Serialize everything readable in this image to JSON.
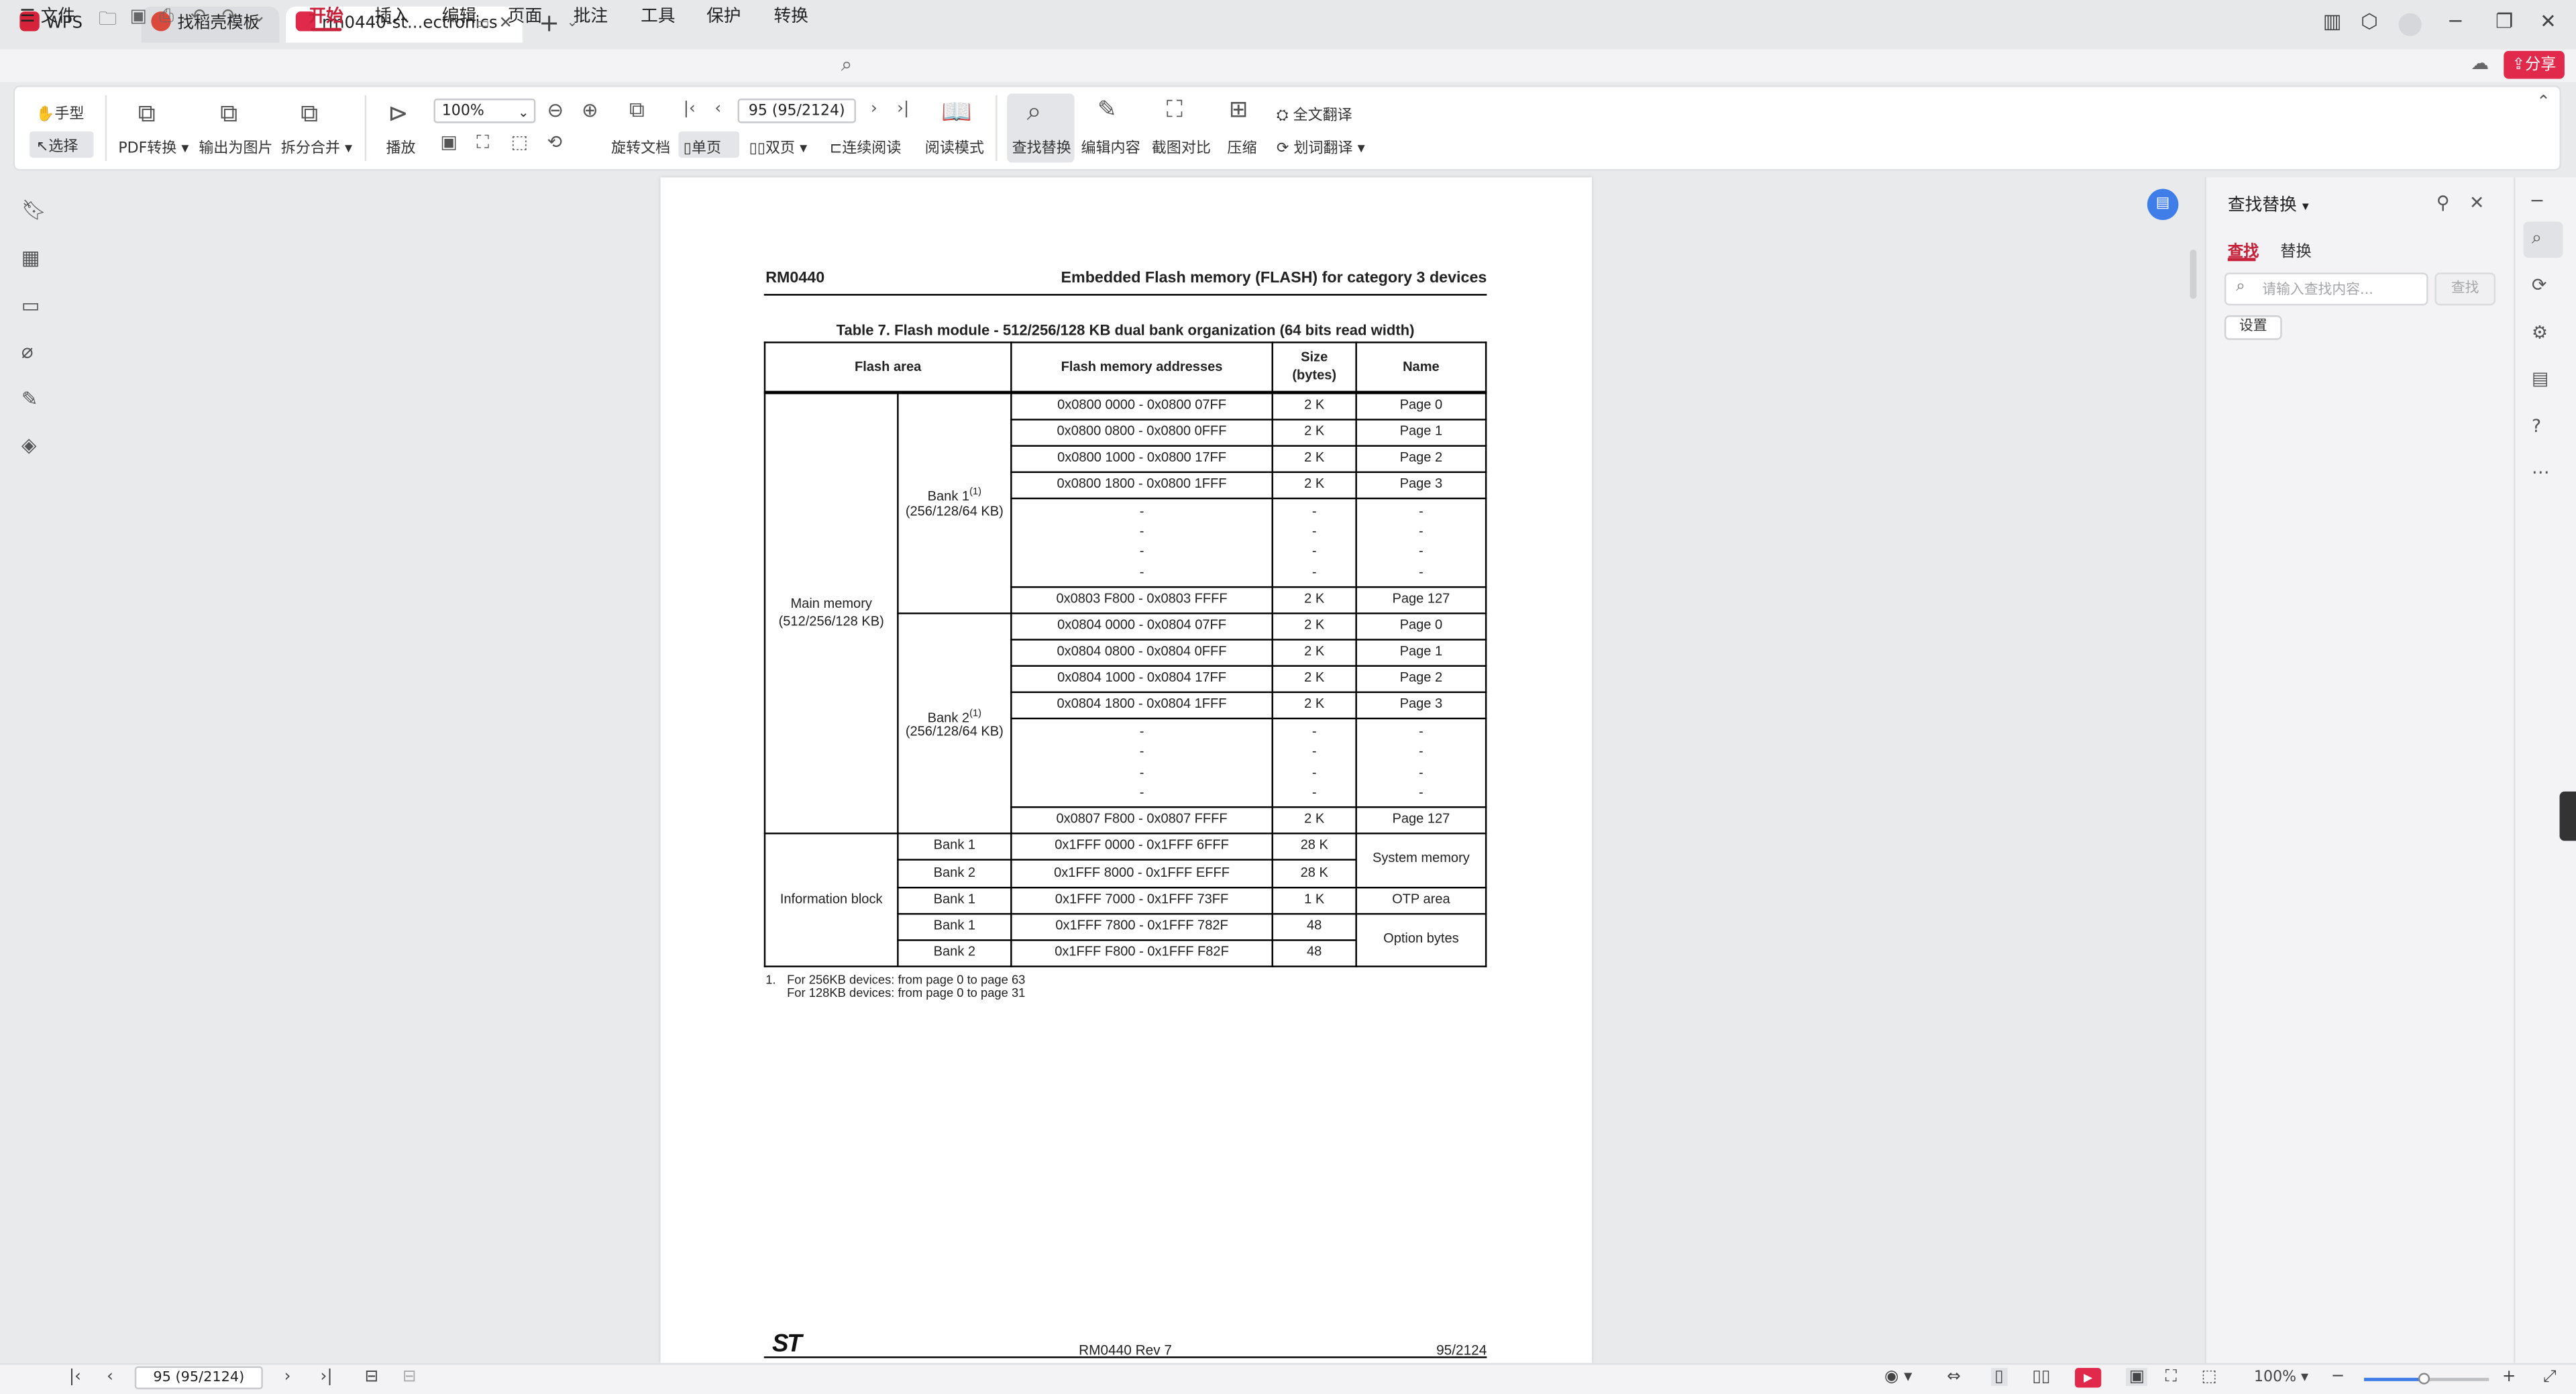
{
  "tabs": [
    {
      "label": "WPS Office",
      "icon": "wps-logo-icon",
      "color": "#d7223b"
    },
    {
      "label": "找稻壳模板",
      "icon": "docer-icon",
      "color": "#d94a3d"
    },
    {
      "label": "rm0440-st...ectronics",
      "icon": "pdf-icon",
      "color": "#e0294b"
    }
  ],
  "menu": {
    "file": "文件",
    "items": [
      "开始",
      "插入",
      "编辑",
      "页面",
      "批注",
      "工具",
      "保护",
      "转换"
    ],
    "share": "分享"
  },
  "ribbon": {
    "hand": "手型",
    "select": "选择",
    "pdf_convert": "PDF转换",
    "export_image": "输出为图片",
    "split_merge": "拆分合并",
    "play": "播放",
    "zoom": "100%",
    "page_box": "95 (95/2124)",
    "rotate": "旋转文档",
    "single": "单页",
    "double": "双页",
    "continuous": "连续阅读",
    "read_mode": "阅读模式",
    "find_replace": "查找替换",
    "edit_content": "编辑内容",
    "screenshot_compare": "截图对比",
    "compress": "压缩",
    "full_translate": "全文翻译",
    "word_translate": "划词翻译"
  },
  "document": {
    "header_left": "RM0440",
    "header_right": "Embedded Flash memory (FLASH) for category 3 devices",
    "caption": "Table 7. Flash module - 512/256/128 KB dual bank organization (64 bits read width)",
    "columns": [
      "Flash area",
      "Flash memory addresses",
      "Size",
      "(bytes)",
      "Name"
    ],
    "main_memory": [
      "Main memory",
      "(512/256/128 KB)"
    ],
    "bank1": {
      "label": "Bank 1",
      "sup": "(1)",
      "sub": "(256/128/64 KB)"
    },
    "bank2": {
      "label": "Bank 2",
      "sup": "(1)",
      "sub": "(256/128/64 KB)"
    },
    "bank1_rows": [
      {
        "addr": "0x0800 0000 - 0x0800 07FF",
        "size": "2 K",
        "name": "Page 0"
      },
      {
        "addr": "0x0800 0800 - 0x0800 0FFF",
        "size": "2 K",
        "name": "Page 1"
      },
      {
        "addr": "0x0800 1000 - 0x0800 17FF",
        "size": "2  K",
        "name": "Page 2"
      },
      {
        "addr": "0x0800 1800 - 0x0800 1FFF",
        "size": "2 K",
        "name": "Page 3"
      },
      {
        "addr": "0x0803 F800 - 0x0803 FFFF",
        "size": "2 K",
        "name": "Page 127"
      }
    ],
    "bank2_rows": [
      {
        "addr": "0x0804 0000 - 0x0804 07FF",
        "size": "2 K",
        "name": "Page 0"
      },
      {
        "addr": "0x0804 0800 - 0x0804 0FFF",
        "size": "2  K",
        "name": "Page 1"
      },
      {
        "addr": "0x0804 1000 - 0x0804 17FF",
        "size": "2 K",
        "name": "Page 2"
      },
      {
        "addr": "0x0804 1800 - 0x0804 1FFF",
        "size": "2 K",
        "name": "Page 3"
      },
      {
        "addr": "0x0807 F800 - 0x0807 FFFF",
        "size": "2 K",
        "name": "Page 127"
      }
    ],
    "dash": "-",
    "info_block": "Information block",
    "info_rows": [
      {
        "bank": "Bank 1",
        "addr": "0x1FFF 0000 - 0x1FFF 6FFF",
        "size": "28 K"
      },
      {
        "bank": "Bank 2",
        "addr": "0x1FFF 8000 - 0x1FFF EFFF",
        "size": "28 K"
      },
      {
        "bank": "Bank 1",
        "addr": "0x1FFF 7000 - 0x1FFF 73FF",
        "size": "1 K"
      },
      {
        "bank": "Bank 1",
        "addr": "0x1FFF 7800 - 0x1FFF 782F",
        "size": "48"
      },
      {
        "bank": "Bank 2",
        "addr": "0x1FFF F800 - 0x1FFF F82F",
        "size": "48"
      }
    ],
    "info_names": [
      "System memory",
      "OTP area",
      "Option bytes"
    ],
    "footnote_num": "1.",
    "footnote_lines": [
      "For 256KB devices: from page 0 to page 63",
      "For 128KB devices: from page 0 to page 31"
    ],
    "footer_logo": "ST",
    "footer_mid": "RM0440 Rev 7",
    "footer_right": "95/2124"
  },
  "find_panel": {
    "title": "查找替换",
    "tab_find": "查找",
    "tab_replace": "替换",
    "placeholder": "请输入查找内容...",
    "find_button": "查找",
    "settings_button": "设置"
  },
  "status": {
    "page_box": "95 (95/2124)",
    "zoom": "100%"
  },
  "colors": {
    "accent": "#c7223a",
    "share": "#e0294b",
    "blue": "#3f7ee8"
  }
}
